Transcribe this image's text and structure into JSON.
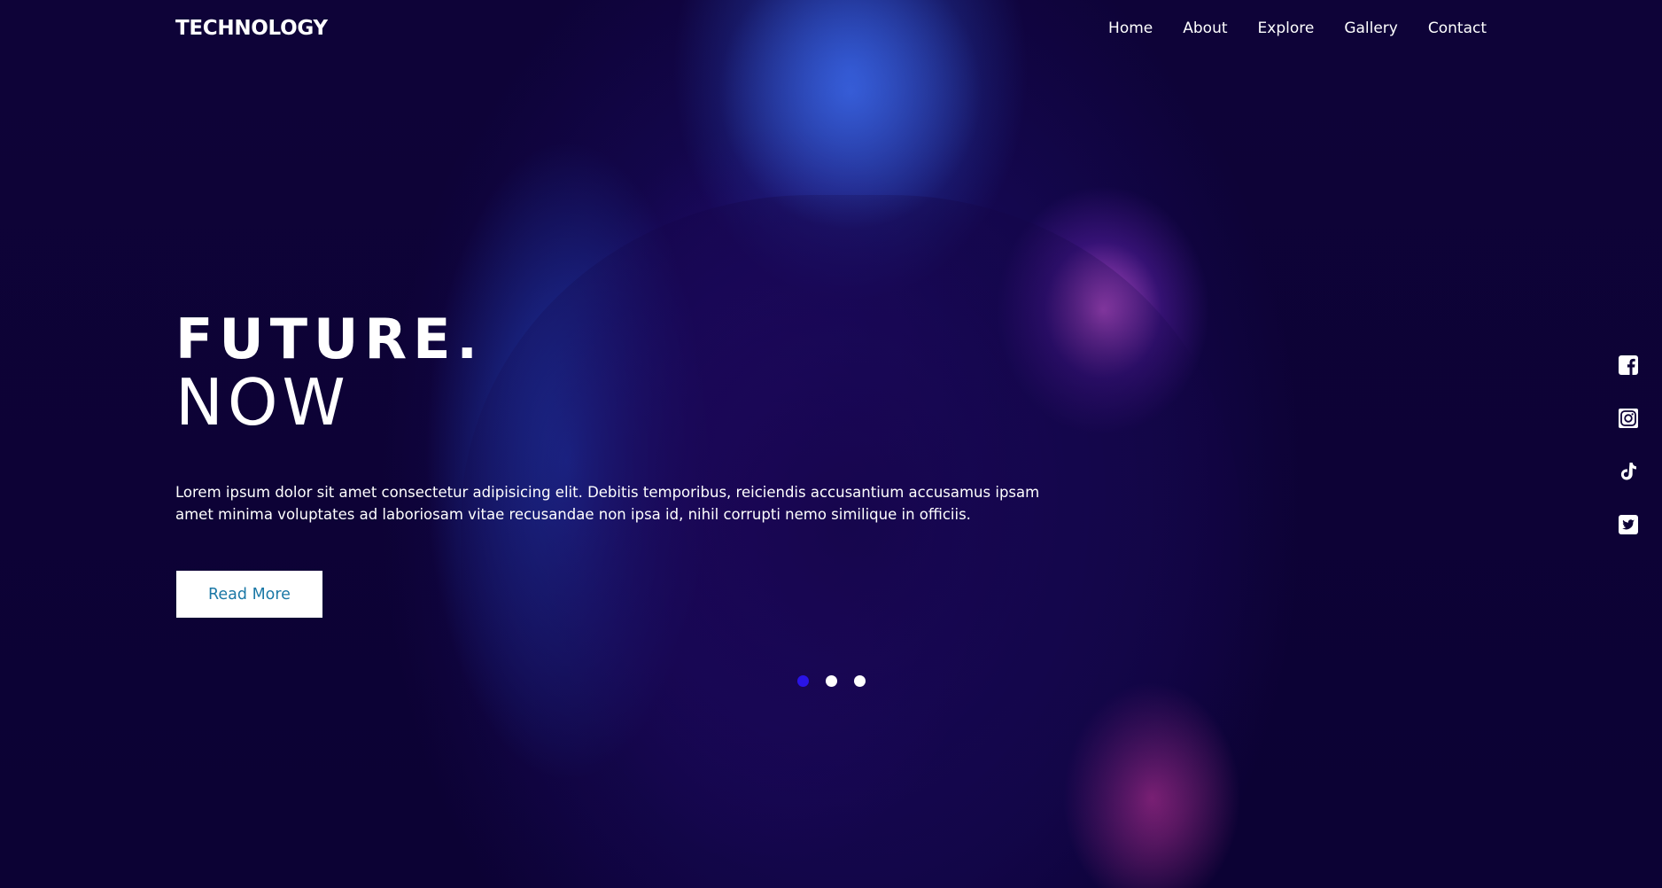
{
  "brand": {
    "name": "TECHNOLOGY"
  },
  "nav": {
    "items": [
      {
        "label": "Home"
      },
      {
        "label": "About"
      },
      {
        "label": "Explore"
      },
      {
        "label": "Gallery"
      },
      {
        "label": "Contact"
      }
    ]
  },
  "hero": {
    "headline_line1": "FUTURE.",
    "headline_line2": "NOW",
    "description": "Lorem ipsum dolor sit amet consectetur adipisicing elit. Debitis temporibus, reiciendis accusantium accusamus ipsam amet minima voluptates ad laboriosam vitae recusandae non ipsa id, nihil corrupti nemo similique in officiis.",
    "cta_label": "Read More"
  },
  "slider": {
    "total": 3,
    "active_index": 0
  },
  "social": {
    "icons": [
      "facebook-icon",
      "instagram-icon",
      "tiktok-icon",
      "twitter-icon"
    ]
  },
  "colors": {
    "background": "#0d0236",
    "accent_dot": "#2a14e6",
    "cta_text": "#1b78a6",
    "text": "#ffffff"
  }
}
